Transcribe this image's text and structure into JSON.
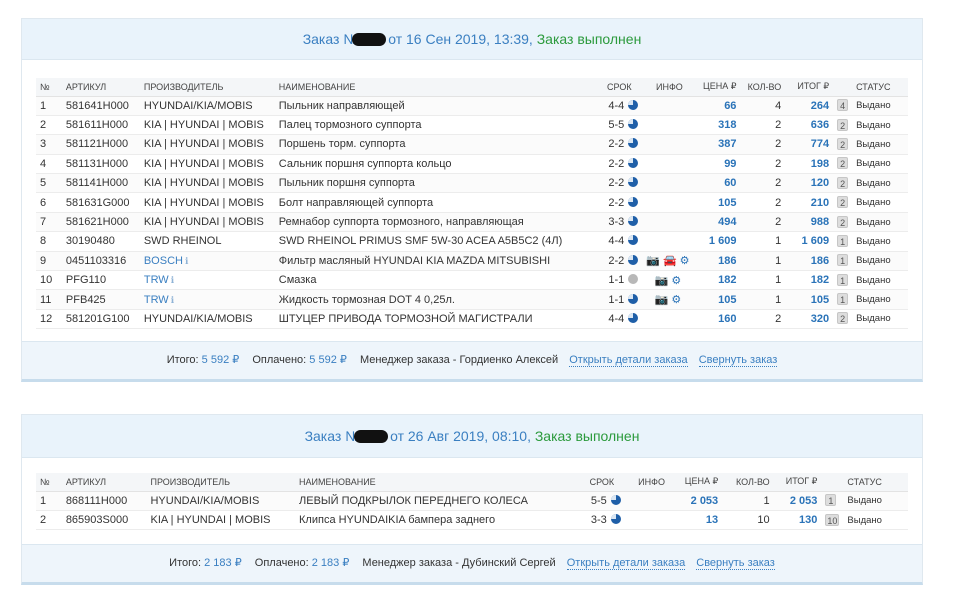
{
  "orders": [
    {
      "title_prefix": "Заказ №",
      "title_suffix": " от 16 Сен 2019, 13:39, ",
      "status": "Заказ выполнен",
      "columns": [
        "№",
        "АРТИКУЛ",
        "ПРОИЗВОДИТЕЛЬ",
        "НАИМЕНОВАНИЕ",
        "СРОК",
        "ИНФО",
        "ЦЕНА ₽",
        "КОЛ-ВО",
        "ИТОГ ₽",
        "СТАТУС"
      ],
      "rows": [
        {
          "n": "1",
          "art": "581641H000",
          "brand": "HYUNDAI/KIA/MOBIS",
          "brand_link": false,
          "name": "Пыльник направляющей",
          "term": "4-4",
          "pie": "blue",
          "info": "",
          "price": "66",
          "qty": "4",
          "total": "264",
          "badge": "4",
          "status": "Выдано"
        },
        {
          "n": "2",
          "art": "581611H000",
          "brand": "KIA | HYUNDAI | MOBIS",
          "brand_link": false,
          "name": "Палец тормозного суппорта",
          "term": "5-5",
          "pie": "blue",
          "info": "",
          "price": "318",
          "qty": "2",
          "total": "636",
          "badge": "2",
          "status": "Выдано"
        },
        {
          "n": "3",
          "art": "581121H000",
          "brand": "KIA | HYUNDAI | MOBIS",
          "brand_link": false,
          "name": "Поршень торм. суппорта",
          "term": "2-2",
          "pie": "blue",
          "info": "",
          "price": "387",
          "qty": "2",
          "total": "774",
          "badge": "2",
          "status": "Выдано"
        },
        {
          "n": "4",
          "art": "581131H000",
          "brand": "KIA | HYUNDAI | MOBIS",
          "brand_link": false,
          "name": "Сальник поршня суппорта кольцо",
          "term": "2-2",
          "pie": "blue",
          "info": "",
          "price": "99",
          "qty": "2",
          "total": "198",
          "badge": "2",
          "status": "Выдано"
        },
        {
          "n": "5",
          "art": "581141H000",
          "brand": "KIA | HYUNDAI | MOBIS",
          "brand_link": false,
          "name": "Пыльник поршня суппорта",
          "term": "2-2",
          "pie": "blue",
          "info": "",
          "price": "60",
          "qty": "2",
          "total": "120",
          "badge": "2",
          "status": "Выдано"
        },
        {
          "n": "6",
          "art": "581631G000",
          "brand": "KIA | HYUNDAI | MOBIS",
          "brand_link": false,
          "name": "Болт направляющей суппорта",
          "term": "2-2",
          "pie": "blue",
          "info": "",
          "price": "105",
          "qty": "2",
          "total": "210",
          "badge": "2",
          "status": "Выдано"
        },
        {
          "n": "7",
          "art": "581621H000",
          "brand": "KIA | HYUNDAI | MOBIS",
          "brand_link": false,
          "name": "Ремнабор суппорта тормозного, направляющая",
          "term": "3-3",
          "pie": "blue",
          "info": "",
          "price": "494",
          "qty": "2",
          "total": "988",
          "badge": "2",
          "status": "Выдано"
        },
        {
          "n": "8",
          "art": "30190480",
          "brand": "SWD RHEINOL",
          "brand_link": false,
          "name": "SWD RHEINOL PRIMUS SMF 5W-30 ACEA A5B5C2 (4Л)",
          "term": "4-4",
          "pie": "blue",
          "info": "",
          "price": "1 609",
          "qty": "1",
          "total": "1 609",
          "badge": "1",
          "status": "Выдано"
        },
        {
          "n": "9",
          "art": "0451103316",
          "brand": "BOSCH",
          "brand_link": true,
          "name": "Фильтр масляный HYUNDAI KIA MAZDA MITSUBISHI",
          "term": "2-2",
          "pie": "blue",
          "info": "camera-car-gear",
          "price": "186",
          "qty": "1",
          "total": "186",
          "badge": "1",
          "status": "Выдано"
        },
        {
          "n": "10",
          "art": "PFG110",
          "brand": "TRW",
          "brand_link": true,
          "name": "Смазка",
          "term": "1-1",
          "pie": "grey",
          "info": "camera-gear",
          "price": "182",
          "qty": "1",
          "total": "182",
          "badge": "1",
          "status": "Выдано"
        },
        {
          "n": "11",
          "art": "PFB425",
          "brand": "TRW",
          "brand_link": true,
          "name": "Жидкость тормозная DOT 4 0,25л.",
          "term": "1-1",
          "pie": "blue",
          "info": "camera-gear",
          "price": "105",
          "qty": "1",
          "total": "105",
          "badge": "1",
          "status": "Выдано"
        },
        {
          "n": "12",
          "art": "581201G100",
          "brand": "HYUNDAI/KIA/MOBIS",
          "brand_link": false,
          "name": "ШТУЦЕР ПРИВОДА ТОРМОЗНОЙ МАГИСТРАЛИ",
          "term": "4-4",
          "pie": "blue",
          "info": "",
          "price": "160",
          "qty": "2",
          "total": "320",
          "badge": "2",
          "status": "Выдано"
        }
      ],
      "footer": {
        "total_label": "Итого:",
        "total_value": "5 592 ₽",
        "paid_label": "Оплачено:",
        "paid_value": "5 592 ₽",
        "manager": "Менеджер заказа - Гордиенко Алексей",
        "details_link": "Открыть детали заказа",
        "collapse_link": "Свернуть заказ"
      }
    },
    {
      "title_prefix": "Заказ №",
      "title_suffix": " от 26 Авг 2019, 08:10, ",
      "status": "Заказ выполнен",
      "columns": [
        "№",
        "АРТИКУЛ",
        "ПРОИЗВОДИТЕЛЬ",
        "НАИМЕНОВАНИЕ",
        "СРОК",
        "ИНФО",
        "ЦЕНА ₽",
        "КОЛ-ВО",
        "ИТОГ ₽",
        "СТАТУС"
      ],
      "rows": [
        {
          "n": "1",
          "art": "868111H000",
          "brand": "HYUNDAI/KIA/MOBIS",
          "brand_link": false,
          "name": "ЛЕВЫЙ ПОДКРЫЛОК ПЕРЕДНЕГО КОЛЕСА",
          "term": "5-5",
          "pie": "blue",
          "info": "",
          "price": "2 053",
          "qty": "1",
          "total": "2 053",
          "badge": "1",
          "status": "Выдано"
        },
        {
          "n": "2",
          "art": "865903S000",
          "brand": "KIA | HYUNDAI | MOBIS",
          "brand_link": false,
          "name": "Клипса HYUNDAIKIA бампера заднего",
          "term": "3-3",
          "pie": "blue",
          "info": "",
          "price": "13",
          "qty": "10",
          "total": "130",
          "badge": "10",
          "status": "Выдано"
        }
      ],
      "footer": {
        "total_label": "Итого:",
        "total_value": "2 183 ₽",
        "paid_label": "Оплачено:",
        "paid_value": "2 183 ₽",
        "manager": "Менеджер заказа - Дубинский Сергей",
        "details_link": "Открыть детали заказа",
        "collapse_link": "Свернуть заказ"
      }
    }
  ],
  "colors": {
    "link": "#3a7fc1",
    "status_ok": "#2b9a3c",
    "header_bg": "#e9f3fb"
  }
}
